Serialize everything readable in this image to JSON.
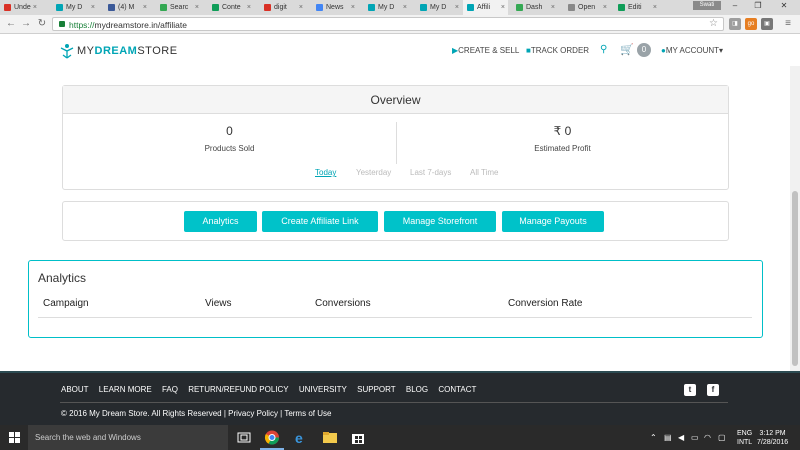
{
  "browser": {
    "tabs": [
      {
        "label": "Unde",
        "color": "#d93025"
      },
      {
        "label": "My D",
        "color": "#00a5b5"
      },
      {
        "label": "(4) M",
        "color": "#3b5998"
      },
      {
        "label": "Searc",
        "color": "#34a853"
      },
      {
        "label": "Conte",
        "color": "#0f9d58"
      },
      {
        "label": "digit",
        "color": "#d93025"
      },
      {
        "label": "News",
        "color": "#4285f4"
      },
      {
        "label": "My D",
        "color": "#00a5b5"
      },
      {
        "label": "My D",
        "color": "#00a5b5"
      },
      {
        "label": "Affili",
        "color": "#00a5b5"
      },
      {
        "label": "Dash",
        "color": "#34a853"
      },
      {
        "label": "Open",
        "color": "#888888"
      },
      {
        "label": "Editi",
        "color": "#0f9d58"
      }
    ],
    "profile": "Swati",
    "url_scheme": "https://",
    "url_rest": "mydreamstore.in/affiliate"
  },
  "site": {
    "logo_my": "MY",
    "logo_dream": "DREAM",
    "logo_store": "STORE",
    "nav": {
      "create_sell": "CREATE & SELL",
      "track_order": "TRACK ORDER",
      "cart_count": "0",
      "my_account": "MY ACCOUNT"
    }
  },
  "overview": {
    "title": "Overview",
    "products_sold_value": "0",
    "products_sold_label": "Products Sold",
    "profit_value": "₹ 0",
    "profit_label": "Estimated Profit",
    "ranges": [
      "Today",
      "Yesterday",
      "Last 7-days",
      "All Time"
    ]
  },
  "actions": {
    "analytics": "Analytics",
    "create_link": "Create Affiliate Link",
    "storefront": "Manage Storefront",
    "payouts": "Manage Payouts"
  },
  "analytics": {
    "title": "Analytics",
    "columns": [
      "Campaign",
      "Views",
      "Conversions",
      "Conversion Rate"
    ]
  },
  "footer": {
    "links": [
      "ABOUT",
      "LEARN MORE",
      "FAQ",
      "RETURN/REFUND POLICY",
      "UNIVERSITY",
      "SUPPORT",
      "BLOG",
      "CONTACT"
    ],
    "copyright": "© 2016 My Dream Store. All Rights Reserved | Privacy Policy | Terms of Use"
  },
  "taskbar": {
    "search_placeholder": "Search the web and Windows",
    "lang_top": "ENG",
    "lang_bottom": "INTL",
    "time": "3:12 PM",
    "date": "7/28/2016"
  },
  "colors": {
    "accent": "#00c2c9",
    "footer_bg": "#262a2e"
  }
}
